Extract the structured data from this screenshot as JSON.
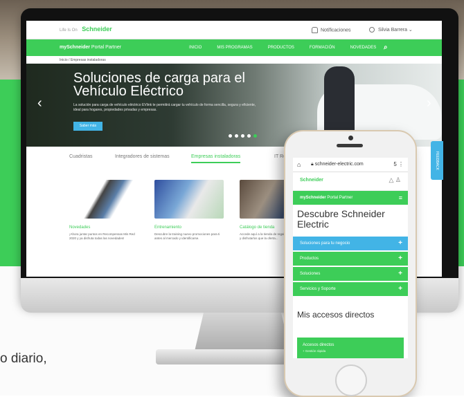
{
  "background": {
    "caption_fragment": "o diario,"
  },
  "desktop": {
    "logo": {
      "brand": "Schneider",
      "sub": "Life Is On"
    },
    "topbar": {
      "notifications": "Notificaciones",
      "user": "Silvia Barrera"
    },
    "nav": {
      "portal_bold": "mySchneider",
      "portal_rest": "Portal Partner",
      "items": [
        "INICIO",
        "MIS PROGRAMAS",
        "PRODUCTOS",
        "FORMACIÓN",
        "NOVEDADES"
      ]
    },
    "breadcrumb": "Inicio / Empresas instaladoras",
    "hero": {
      "title": "Soluciones de carga para el Vehículo Eléctrico",
      "description": "La solución para carga de vehículo eléctrico EVlink te permitirá cargar tu vehículo de forma sencilla, segura y eficiente, ideal para hogares, propiedades privadas y empresas.",
      "button": "Saber más"
    },
    "tabs": [
      "Cuadristas",
      "Integradores de sistemas",
      "Empresas instaladoras",
      "IT Re"
    ],
    "cards": [
      {
        "title": "Novedades",
        "text": "¡Ahora juntar puntos en Recompensas Mis Red 2020 y ya disfruta todas las novedades!"
      },
      {
        "title": "Entrenamiento",
        "text": "Descubre la training nuevo promociones para ti antes al mercado y identificarse."
      },
      {
        "title": "Catálogo de tienda",
        "text": "Accede aquí a la tienda de regalos para incluirlos y disfrutarlos que la oferta..."
      }
    ],
    "feedback_label": "FEEDBACK"
  },
  "phone": {
    "url": "schneider-electric.com",
    "tab_count": "5",
    "portal_bold": "mySchneider",
    "portal_rest": "Portal Partner",
    "title": "Descubre Schneider Electric",
    "menu": [
      {
        "label": "Soluciones para tu negocio",
        "highlight": true
      },
      {
        "label": "Productos",
        "highlight": false
      },
      {
        "label": "Soluciones",
        "highlight": false
      },
      {
        "label": "Servicios y Soporte",
        "highlight": false
      }
    ],
    "subtitle": "Mis accesos directos",
    "shortcut": {
      "title": "Accesos directos",
      "sub": "+ Gestión rápida"
    }
  },
  "colors": {
    "brand_green": "#3dcd58",
    "accent_blue": "#42b4e6"
  }
}
